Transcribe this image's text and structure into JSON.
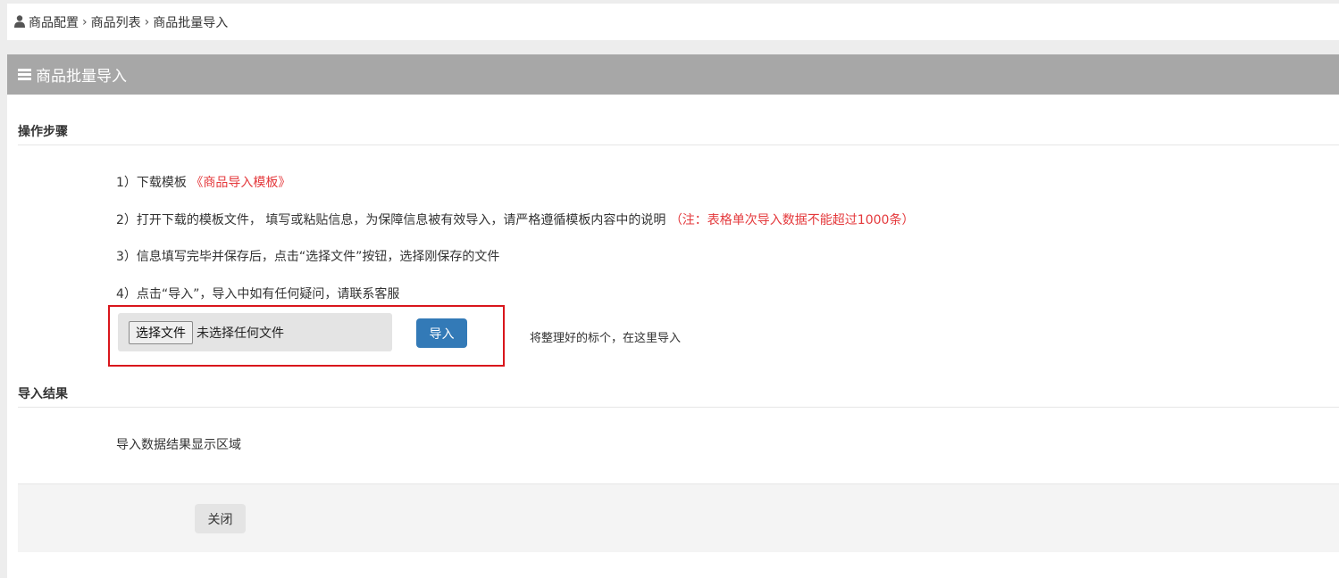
{
  "breadcrumb": {
    "icon": "user-icon",
    "items": [
      "商品配置",
      "商品列表",
      "商品批量导入"
    ],
    "separator": "›"
  },
  "panel": {
    "title": "商品批量导入",
    "title_icon": "bars-icon"
  },
  "steps_section": {
    "title": "操作步骤",
    "steps": [
      {
        "prefix": "1）下载模板 ",
        "link": "《商品导入模板》"
      },
      {
        "text": "2）打开下载的模板文件， 填写或粘贴信息，为保障信息被有效导入，请严格遵循模板内容中的说明 ",
        "note": "（注：表格单次导入数据不能超过1000条）"
      },
      {
        "text": "3）信息填写完毕并保存后，点击“选择文件”按钮，选择刚保存的文件"
      },
      {
        "text": "4）点击“导入”，导入中如有任何疑问，请联系客服"
      }
    ]
  },
  "upload": {
    "choose_file_label": "选择文件",
    "file_status": "未选择任何文件",
    "import_label": "导入",
    "hint": "将整理好的标个，在这里导入"
  },
  "result_section": {
    "title": "导入结果",
    "placeholder": "导入数据结果显示区域"
  },
  "footer": {
    "close_label": "关闭"
  },
  "colors": {
    "header_bg": "#a7a7a7",
    "accent_red": "#e4393c",
    "primary_button": "#337ab7",
    "highlight_border": "#d9161c"
  }
}
